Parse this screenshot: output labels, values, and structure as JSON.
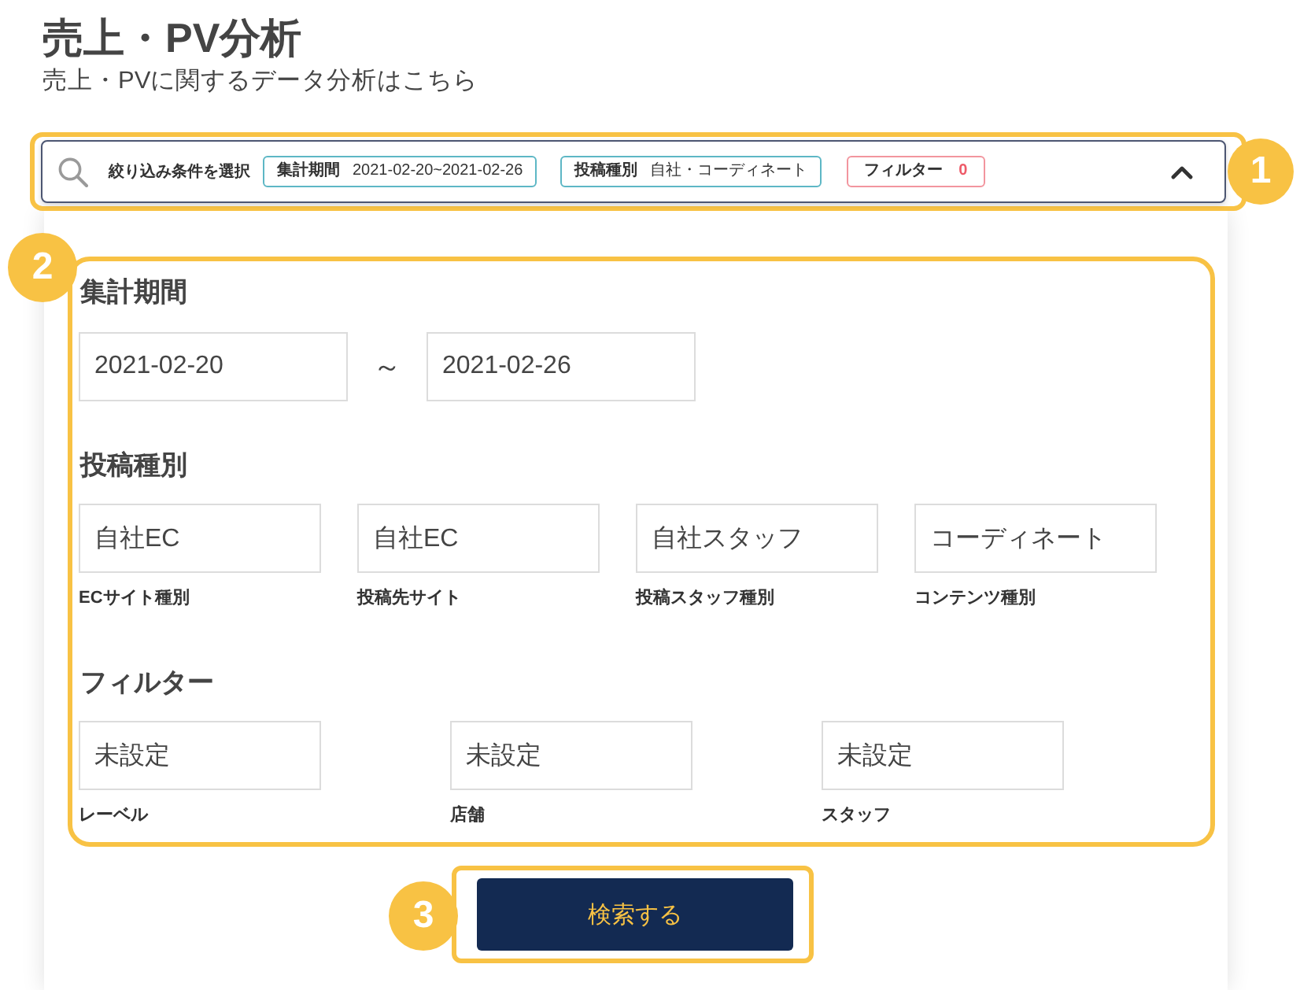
{
  "header": {
    "title": "売上・PV分析",
    "subtitle": "売上・PVに関するデータ分析はこちら"
  },
  "filter_bar": {
    "callout": "1",
    "label": "絞り込み条件を選択",
    "expanded": true,
    "chips": [
      {
        "kind": "info",
        "name": "集計期間",
        "value": "2021-02-20~2021-02-26"
      },
      {
        "kind": "info",
        "name": "投稿種別",
        "value": "自社・コーディネート"
      },
      {
        "kind": "alert",
        "name": "フィルター",
        "value": "0"
      }
    ]
  },
  "filter_panel": {
    "callout": "2",
    "sections": [
      {
        "kind": "range",
        "heading": "集計期間",
        "from": "2021-02-20",
        "separator": "～",
        "to": "2021-02-26"
      },
      {
        "kind": "selects",
        "heading": "投稿種別",
        "fields": [
          {
            "value": "自社EC",
            "caption": "ECサイト種別"
          },
          {
            "value": "自社EC",
            "caption": "投稿先サイト"
          },
          {
            "value": "自社スタッフ",
            "caption": "投稿スタッフ種別"
          },
          {
            "value": "コーディネート",
            "caption": "コンテンツ種別"
          }
        ]
      },
      {
        "kind": "filters",
        "heading": "フィルター",
        "fields": [
          {
            "value": "未設定",
            "caption": "レーベル"
          },
          {
            "value": "未設定",
            "caption": "店舗"
          },
          {
            "value": "未設定",
            "caption": "スタッフ"
          }
        ]
      }
    ]
  },
  "search_button": {
    "callout": "3",
    "label": "検索する"
  }
}
